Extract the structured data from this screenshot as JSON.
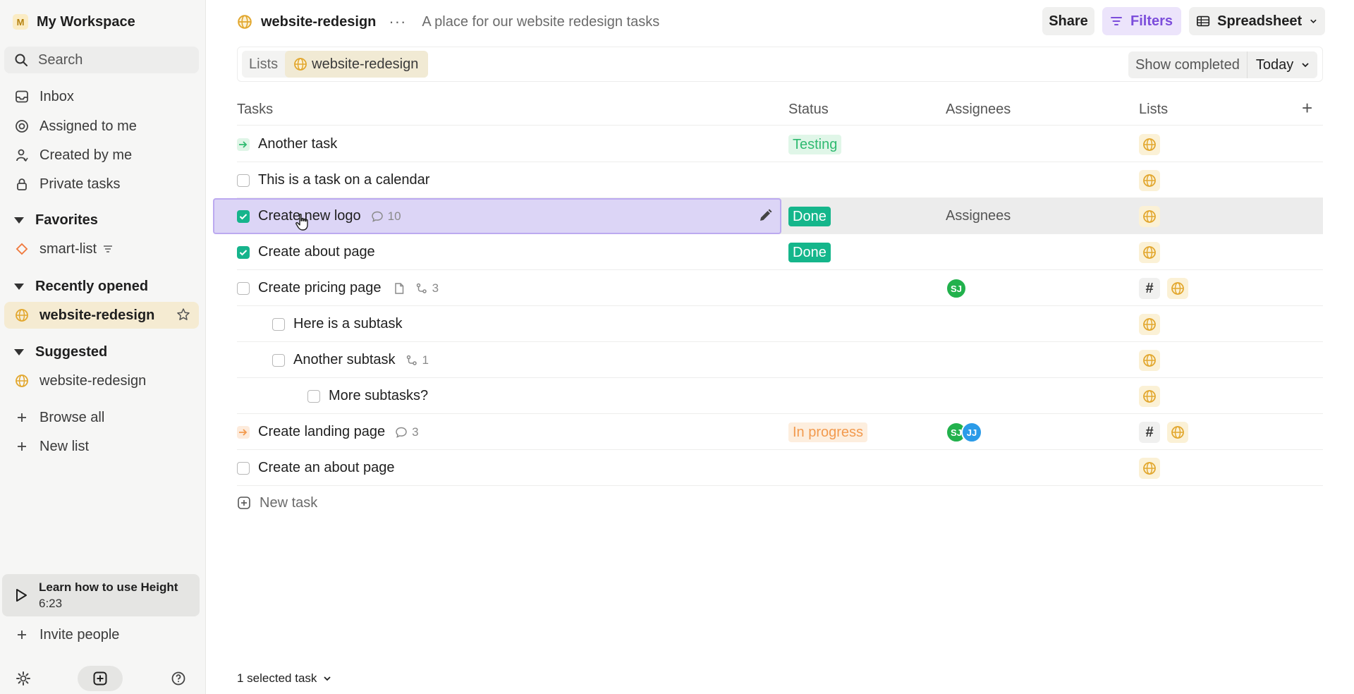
{
  "workspace": {
    "initial": "M",
    "name": "My Workspace"
  },
  "search": {
    "placeholder": "Search"
  },
  "nav": [
    {
      "label": "Inbox",
      "icon": "inbox-icon"
    },
    {
      "label": "Assigned to me",
      "icon": "target-icon"
    },
    {
      "label": "Created by me",
      "icon": "user-icon"
    },
    {
      "label": "Private tasks",
      "icon": "lock-icon"
    }
  ],
  "favorites": {
    "title": "Favorites",
    "items": [
      {
        "label": "smart-list",
        "icon": "diamond-icon"
      }
    ]
  },
  "recent": {
    "title": "Recently opened",
    "items": [
      {
        "label": "website-redesign",
        "icon": "globe-icon"
      }
    ]
  },
  "suggested": {
    "title": "Suggested",
    "items": [
      {
        "label": "website-redesign",
        "icon": "globe-icon"
      }
    ]
  },
  "actions": [
    {
      "label": "Browse all"
    },
    {
      "label": "New list"
    }
  ],
  "learn": {
    "title": "Learn how to use Height",
    "duration": "6:23"
  },
  "invite": {
    "label": "Invite people"
  },
  "header": {
    "title": "website-redesign",
    "more": "···",
    "description": "A place for our website redesign tasks",
    "share": "Share",
    "filters": "Filters",
    "view": "Spreadsheet"
  },
  "subbar": {
    "lists": "Lists",
    "current": "website-redesign",
    "show_completed": "Show completed",
    "date": "Today"
  },
  "columns": {
    "tasks": "Tasks",
    "status": "Status",
    "assignees": "Assignees",
    "lists": "Lists",
    "add": "+"
  },
  "tasks": [
    {
      "name": "Another task",
      "status": "Testing"
    },
    {
      "name": "This is a task on a calendar"
    },
    {
      "name": "Create new logo",
      "comments": "10",
      "status": "Done",
      "assignees_placeholder": "Assignees"
    },
    {
      "name": "Create about page",
      "status": "Done"
    },
    {
      "name": "Create pricing page",
      "subtasks": "3",
      "avatars": [
        "SJ"
      ],
      "hash": "#"
    },
    {
      "name": "Here is a subtask"
    },
    {
      "name": "Another subtask",
      "subtasks": "1"
    },
    {
      "name": "More subtasks?"
    },
    {
      "name": "Create landing page",
      "comments": "3",
      "status": "In progress",
      "avatars": [
        "SJ",
        "JJ"
      ],
      "hash": "#"
    },
    {
      "name": "Create an about page"
    }
  ],
  "new_task": "New task",
  "footer": {
    "selected": "1 selected task"
  },
  "colors": {
    "accent_purple": "#7c4ddb",
    "done_green": "#15b68b",
    "testing_green": "#2fba70",
    "progress_orange": "#f29a4e",
    "globe_gold": "#e2a72e"
  }
}
